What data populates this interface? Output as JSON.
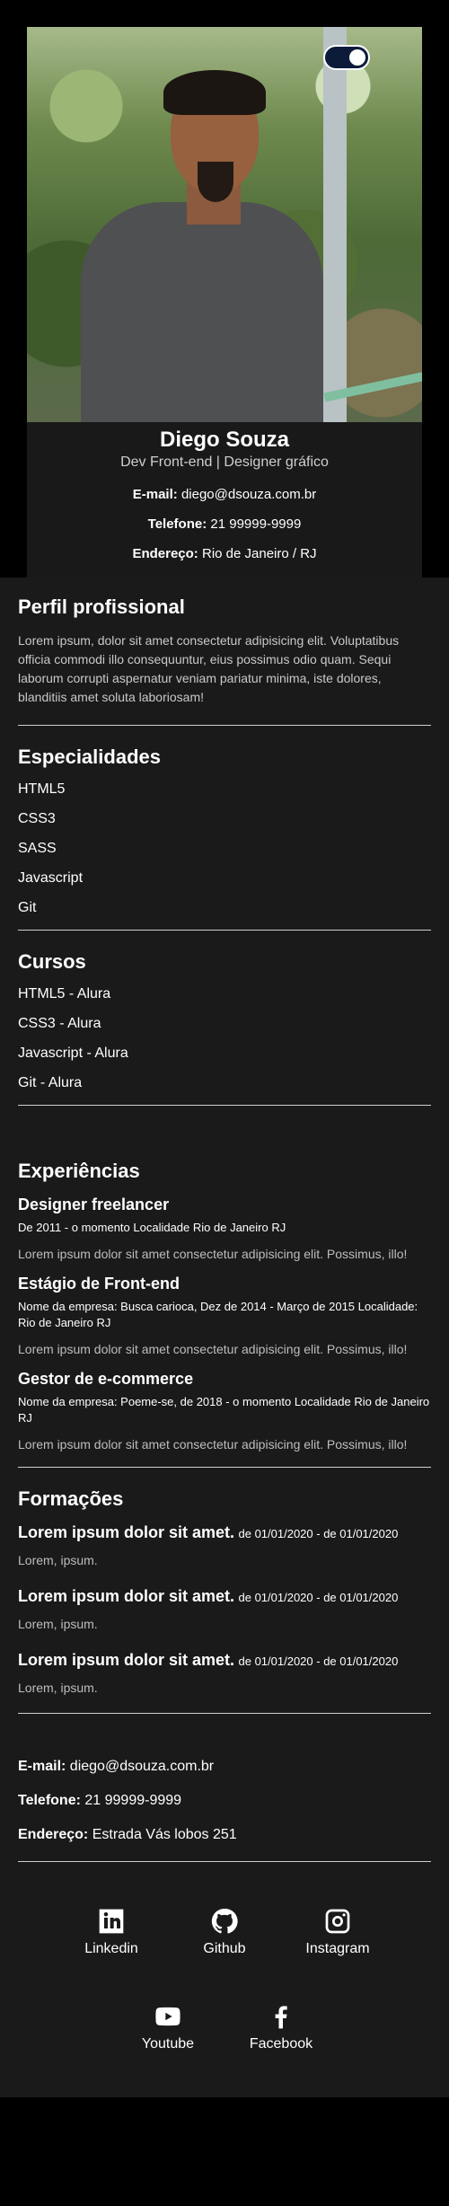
{
  "profile": {
    "name": "Diego Souza",
    "role": "Dev Front-end | Designer gráfico",
    "email_label": "E-mail:",
    "email": "diego@dsouza.com.br",
    "phone_label": "Telefone:",
    "phone": "21 99999-9999",
    "address_label": "Endereço:",
    "address": "Rio de Janeiro / RJ"
  },
  "perfil": {
    "title": "Perfil profissional",
    "text": "Lorem ipsum, dolor sit amet consectetur adipisicing elit. Voluptatibus officia commodi illo consequuntur, eius possimus odio quam. Sequi laborum corrupti aspernatur veniam pariatur minima, iste dolores, blanditiis amet soluta laboriosam!"
  },
  "especialidades": {
    "title": "Especialidades",
    "items": [
      "HTML5",
      "CSS3",
      "SASS",
      "Javascript",
      "Git"
    ]
  },
  "cursos": {
    "title": "Cursos",
    "items": [
      "HTML5 - Alura",
      "CSS3 - Alura",
      "Javascript - Alura",
      "Git - Alura"
    ]
  },
  "experiencias": {
    "title": "Experiências",
    "items": [
      {
        "title": "Designer freelancer",
        "meta": "De 2011 - o momento Localidade Rio de Janeiro RJ",
        "desc": "Lorem ipsum dolor sit amet consectetur adipisicing elit. Possimus, illo!"
      },
      {
        "title": "Estágio de Front-end",
        "meta": "Nome da empresa: Busca carioca, Dez de 2014 - Março de 2015 Localidade: Rio de Janeiro RJ",
        "desc": "Lorem ipsum dolor sit amet consectetur adipisicing elit. Possimus, illo!"
      },
      {
        "title": "Gestor de e-commerce",
        "meta": "Nome da empresa: Poeme-se, de 2018 - o momento Localidade Rio de Janeiro RJ",
        "desc": "Lorem ipsum dolor sit amet consectetur adipisicing elit. Possimus, illo!"
      }
    ]
  },
  "formacoes": {
    "title": "Formações",
    "items": [
      {
        "title": "Lorem ipsum dolor sit amet.",
        "date": "de 01/01/2020 - de 01/01/2020",
        "desc": "Lorem, ipsum."
      },
      {
        "title": "Lorem ipsum dolor sit amet.",
        "date": "de 01/01/2020 - de 01/01/2020",
        "desc": "Lorem, ipsum."
      },
      {
        "title": "Lorem ipsum dolor sit amet.",
        "date": "de 01/01/2020 - de 01/01/2020",
        "desc": "Lorem, ipsum."
      }
    ]
  },
  "footer": {
    "email_label": "E-mail:",
    "email": "diego@dsouza.com.br",
    "phone_label": "Telefone:",
    "phone": "21 99999-9999",
    "address_label": "Endereço:",
    "address": "Estrada Vás lobos 251"
  },
  "social": [
    {
      "label": "Linkedin",
      "icon": "linkedin-icon"
    },
    {
      "label": "Github",
      "icon": "github-icon"
    },
    {
      "label": "Instagram",
      "icon": "instagram-icon"
    },
    {
      "label": "Youtube",
      "icon": "youtube-icon"
    },
    {
      "label": "Facebook",
      "icon": "facebook-icon"
    }
  ]
}
